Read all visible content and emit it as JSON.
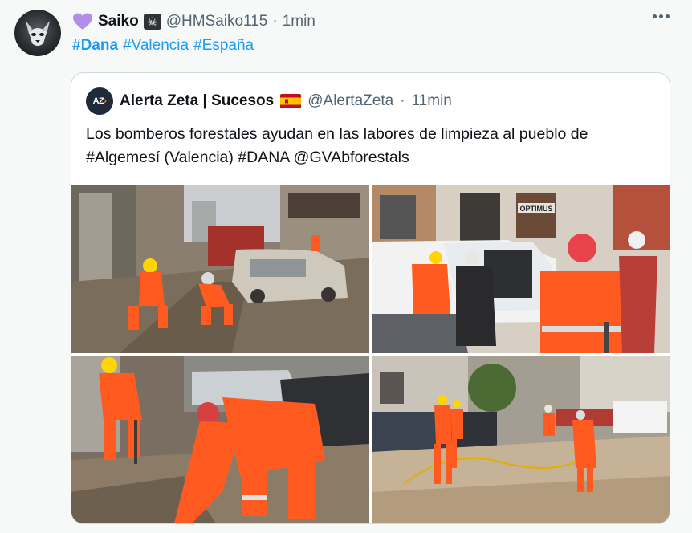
{
  "post": {
    "author_name": "Saiko",
    "handle": "@HMSaiko115",
    "separator": "·",
    "time": "1min",
    "hashtags": [
      {
        "text": "#Dana",
        "bold": true
      },
      {
        "text": "#Valencia",
        "bold": false
      },
      {
        "text": "#España",
        "bold": false
      }
    ]
  },
  "quoted": {
    "avatar_text": "AZ",
    "author_name": "Alerta Zeta | Sucesos",
    "handle": "@AlertaZeta",
    "separator": "·",
    "time": "11min",
    "text_line1": "Los bomberos forestales ayudan en las labores de limpieza al pueblo de",
    "text_line2": "#Algemesí (Valencia) #DANA @GVAbforestals",
    "photos": [
      {
        "signs": [
          "OPTIMUS"
        ]
      }
    ]
  },
  "icons": {
    "heart": "purple-heart-icon",
    "skull": "skull-crossbones-icon",
    "flag": "spain-flag-icon",
    "more": "more-options-icon"
  },
  "colors": {
    "link": "#1d9bf0",
    "muted": "#536471",
    "heart": "#b18ee8",
    "uniform_orange": "#ff5a1f"
  }
}
